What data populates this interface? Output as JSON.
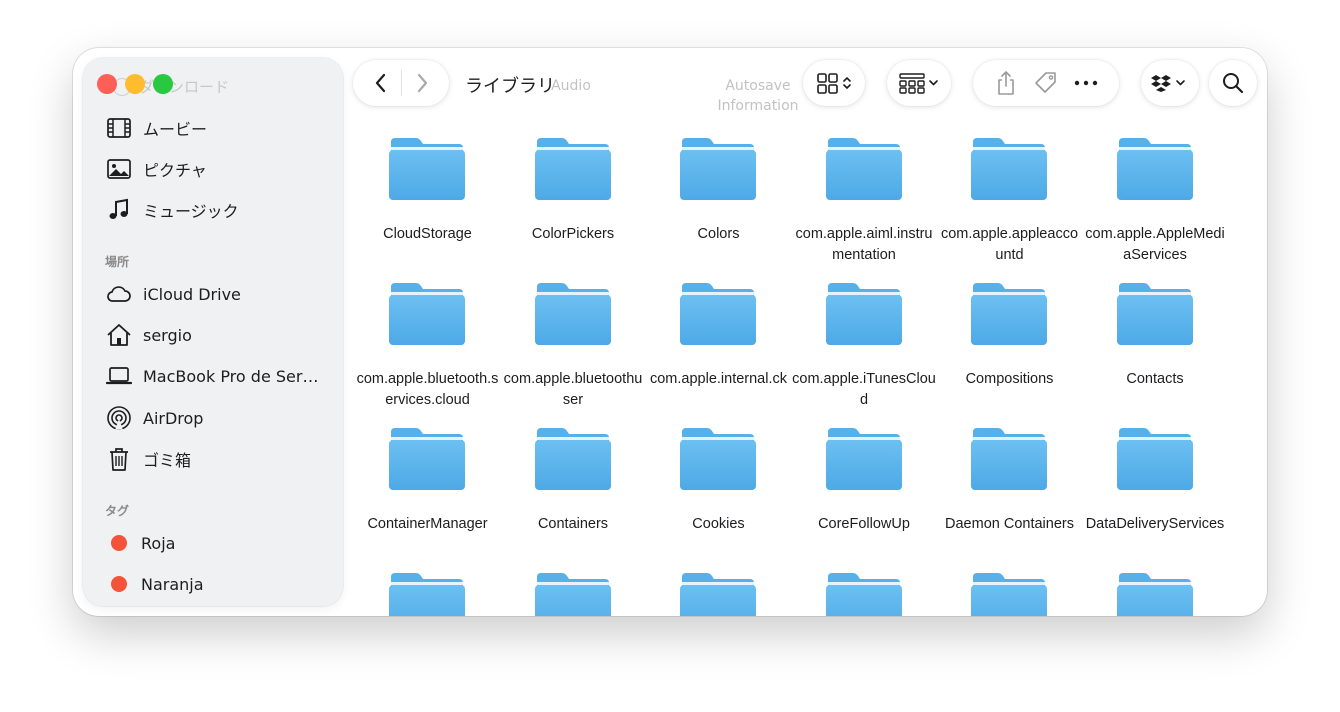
{
  "window": {
    "title": "ライブラリ",
    "toolbar_ghost_labels": [
      "Audio",
      "Autosave Information"
    ]
  },
  "sidebar": {
    "ghost_item": "ダウンロード",
    "items": [
      {
        "label": "ムービー",
        "icon": "film-icon"
      },
      {
        "label": "ピクチャ",
        "icon": "photo-icon"
      },
      {
        "label": "ミュージック",
        "icon": "music-note-icon"
      }
    ],
    "places_header": "場所",
    "places": [
      {
        "label": "iCloud Drive",
        "icon": "cloud-icon"
      },
      {
        "label": "sergio",
        "icon": "home-icon"
      },
      {
        "label": "MacBook Pro de Ser…",
        "icon": "laptop-icon"
      },
      {
        "label": "AirDrop",
        "icon": "airdrop-icon"
      },
      {
        "label": "ゴミ箱",
        "icon": "trash-icon"
      }
    ],
    "tags_header": "タグ",
    "tags": [
      {
        "label": "Roja",
        "color": "#f4533a"
      },
      {
        "label": "Naranja",
        "color": "#f4533a"
      }
    ]
  },
  "toolbar": {
    "back_icon": "chevron-left-icon",
    "forward_icon": "chevron-right-icon",
    "view_icon": "grid-view-icon",
    "group_icon": "group-by-icon",
    "share_icon": "share-icon",
    "tag_icon": "tag-icon",
    "more_icon": "ellipsis-icon",
    "dropbox_icon": "dropbox-icon",
    "search_icon": "search-icon"
  },
  "folders": [
    {
      "name": "CloudStorage"
    },
    {
      "name": "ColorPickers"
    },
    {
      "name": "Colors"
    },
    {
      "name": "com.apple.aiml.instrumentation"
    },
    {
      "name": "com.apple.appleaccountd"
    },
    {
      "name": "com.apple.AppleMediaServices"
    },
    {
      "name": "com.apple.bluetooth.services.cloud"
    },
    {
      "name": "com.apple.bluetoothuser"
    },
    {
      "name": "com.apple.internal.ck"
    },
    {
      "name": "com.apple.iTunesCloud"
    },
    {
      "name": "Compositions"
    },
    {
      "name": "Contacts"
    },
    {
      "name": "ContainerManager"
    },
    {
      "name": "Containers"
    },
    {
      "name": "Cookies"
    },
    {
      "name": "CoreFollowUp"
    },
    {
      "name": "Daemon Containers"
    },
    {
      "name": "DataDeliveryServices"
    },
    {
      "name": ""
    },
    {
      "name": ""
    },
    {
      "name": ""
    },
    {
      "name": ""
    },
    {
      "name": ""
    },
    {
      "name": ""
    }
  ],
  "colors": {
    "folder_top": "#6cc0f2",
    "folder_bottom": "#4da9e6",
    "folder_tab": "#56b1ea"
  }
}
